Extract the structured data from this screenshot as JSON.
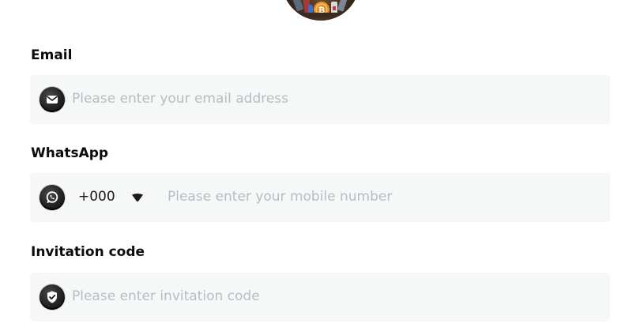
{
  "form": {
    "email": {
      "label": "Email",
      "placeholder": "Please enter your email address",
      "icon": "envelope-icon"
    },
    "whatsapp": {
      "label": "WhatsApp",
      "country_code": "+000",
      "placeholder": "Please enter your mobile number",
      "icon": "whatsapp-icon"
    },
    "invitation": {
      "label": "Invitation code",
      "placeholder": "Please enter invitation code",
      "icon": "shield-check-icon"
    }
  },
  "colors": {
    "field_background": "#f6f7f7",
    "placeholder": "#b8bcc4",
    "label": "#0b0b0b"
  }
}
